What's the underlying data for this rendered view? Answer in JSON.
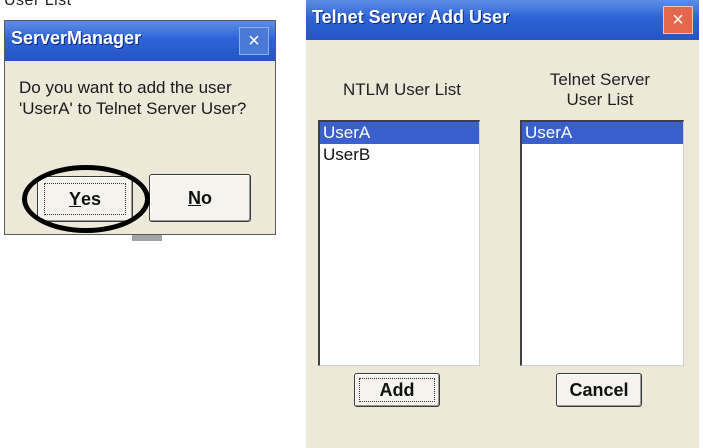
{
  "background": {
    "fragment_text": "User List"
  },
  "server_manager": {
    "title": "ServerManager",
    "close_glyph": "×",
    "message": "Do you want to add the user 'UserA' to Telnet Server User?",
    "yes": {
      "mnemonic": "Y",
      "rest": "es"
    },
    "no": {
      "mnemonic": "N",
      "rest": "o"
    },
    "highlight_color": "#000000"
  },
  "telnet_dialog": {
    "title": "Telnet Server Add User",
    "close_glyph": "×",
    "ntlm_header": "NTLM User List",
    "telnet_header_line1": "Telnet Server",
    "telnet_header_line2": "User List",
    "ntlm_users": [
      "UserA",
      "UserB"
    ],
    "ntlm_selected": "UserA",
    "telnet_users": [
      "UserA"
    ],
    "telnet_selected": "UserA",
    "add_label": "Add",
    "cancel_label": "Cancel"
  },
  "colors": {
    "titlebar": "#2e63d6",
    "selection": "#3a5fce",
    "dialog_face": "#ece9d8",
    "close_red": "#e4674c"
  }
}
